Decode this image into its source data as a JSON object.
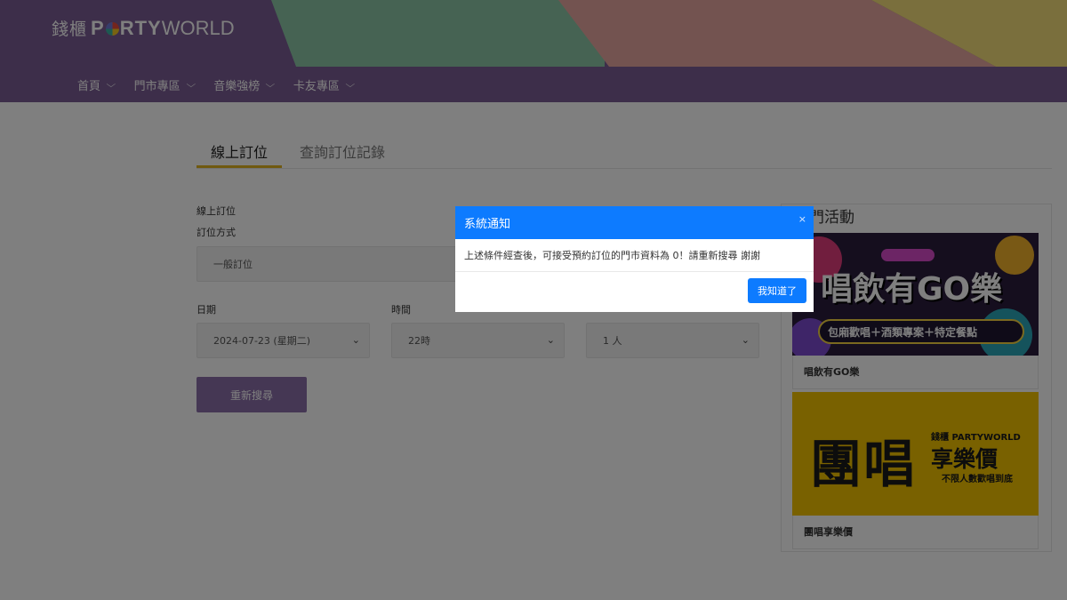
{
  "header": {
    "logo_cn": "錢櫃",
    "logo_party_prefix": "P",
    "logo_party_suffix": "RTY",
    "logo_world": "WORLD"
  },
  "nav": {
    "items": [
      {
        "label": "首頁"
      },
      {
        "label": "門市專區"
      },
      {
        "label": "音樂強榜"
      },
      {
        "label": "卡友專區"
      }
    ]
  },
  "tabs": [
    {
      "label": "線上訂位"
    },
    {
      "label": "查詢訂位記錄"
    }
  ],
  "form": {
    "title": "線上訂位",
    "method_label": "訂位方式",
    "method_value": "一般訂位",
    "date_label": "日期",
    "date_value": "2024-07-23 (星期二)",
    "time_label": "時間",
    "time_value": "22時",
    "people_value": "1 人",
    "research_button": "重新搜尋"
  },
  "sidebar": {
    "title": "熱門活動",
    "promos": [
      {
        "caption": "唱飲有GO樂",
        "img_text_main": "唱飲有GO樂",
        "img_text_sub": "包廂歡唱＋酒類專案＋特定餐點"
      },
      {
        "caption": "團唱享樂價",
        "img_text_main": "團唱",
        "img_text_side": "享樂價",
        "img_text_sub": "不限人數歡唱到底",
        "img_brand": "錢櫃 PARTYWORLD"
      }
    ]
  },
  "modal": {
    "title": "系統通知",
    "close": "×",
    "message": "上述條件經查後，可接受預約訂位的門市資料為 0！請重新搜尋 謝謝",
    "ok_button": "我知道了"
  },
  "colors": {
    "brand_purple": "#7b5d94",
    "band_green": "#8cc7a6",
    "band_pink": "#e7a7a0",
    "band_yellow": "#f4de7a",
    "accent_yellow": "#e0b420",
    "modal_blue": "#0d7bff"
  }
}
